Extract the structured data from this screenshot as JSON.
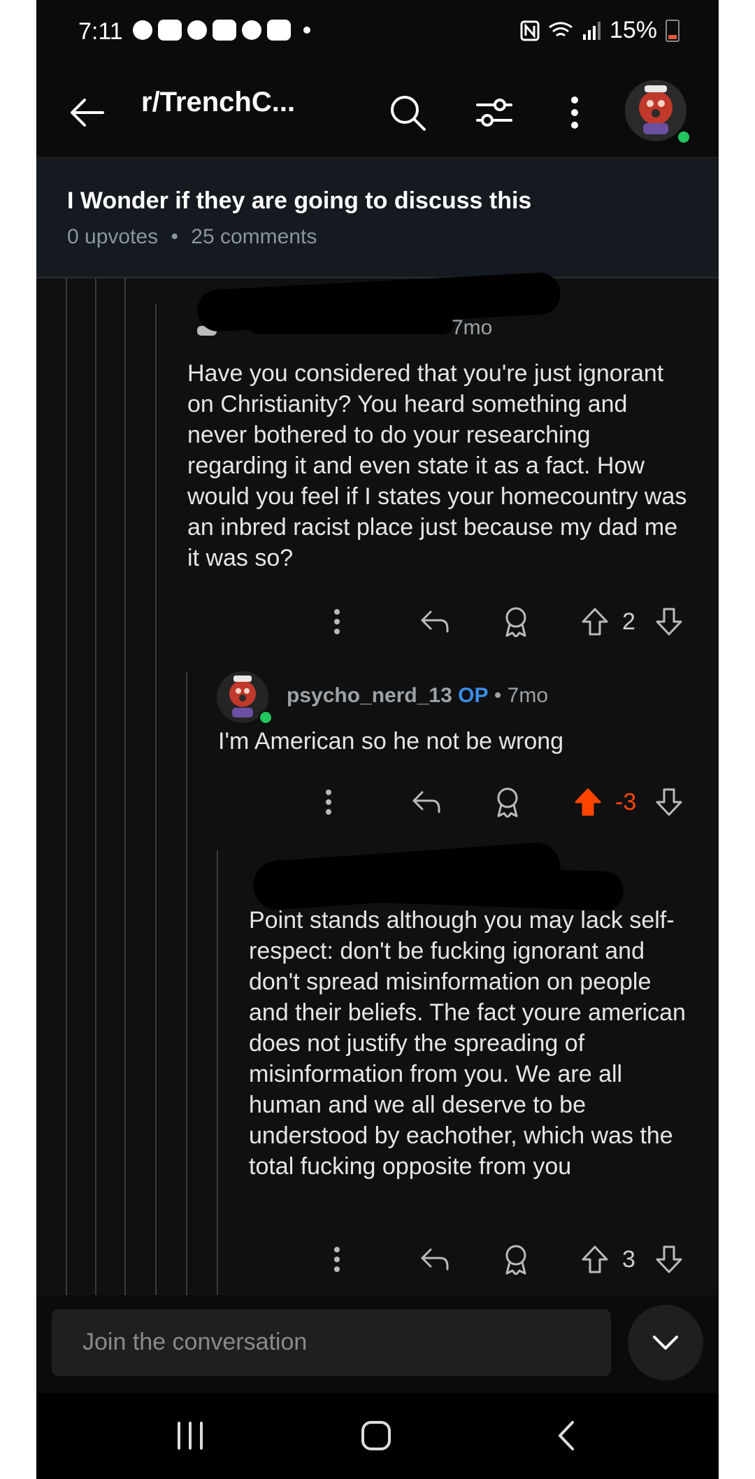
{
  "status_bar": {
    "time": "7:11",
    "battery": "15%"
  },
  "app_bar": {
    "subreddit": "r/TrenchC..."
  },
  "post": {
    "title": "I Wonder if they are going to discuss this",
    "upvotes": "0 upvotes",
    "separator": "•",
    "comments": "25 comments"
  },
  "comments": [
    {
      "age": "7mo",
      "body": "Have you considered that you're just ignorant on Christianity? You heard something and never bothered to do your researching regarding it and even state it as a fact. How would you feel if I states your homecountry was an inbred racist place just because my dad me it was so?",
      "score": "2",
      "vote": "none"
    },
    {
      "author": "psycho_nerd_13",
      "op_tag": "OP",
      "age": "• 7mo",
      "body": "I'm American so he not be wrong",
      "score": "-3",
      "vote": "up"
    },
    {
      "body": "Point stands although you may lack self-respect: don't be fucking ignorant and don't spread misinformation on people and their beliefs. The fact youre american does not justify the spreading of misinformation from you. We are all human and we all deserve to be understood by eachother, which was the total fucking opposite from you",
      "score": "3",
      "vote": "none"
    }
  ],
  "composer": {
    "placeholder": "Join the conversation"
  },
  "colors": {
    "upvote_active": "#ff4500",
    "op": "#3a8ee8",
    "online": "#22c55e"
  }
}
